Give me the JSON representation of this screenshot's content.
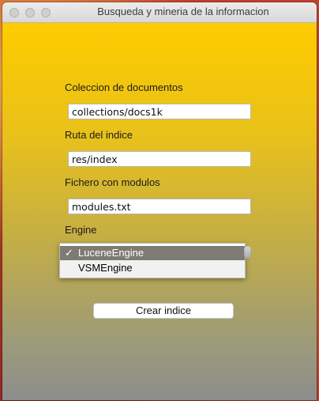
{
  "window": {
    "title": "Busqueda y mineria de la informacion"
  },
  "form": {
    "collection_label": "Coleccion de documentos",
    "collection_value": "collections/docs1k",
    "index_label": "Ruta del indice",
    "index_value": "res/index",
    "modules_label": "Fichero con modulos",
    "modules_value": "modules.txt",
    "engine_label": "Engine",
    "engine_options": [
      {
        "label": "LuceneEngine",
        "selected": true
      },
      {
        "label": "VSMEngine",
        "selected": false
      }
    ],
    "check_mark": "✓",
    "create_button_label": "Crear indice"
  },
  "colors": {
    "gradient_top": "#ffcc00",
    "gradient_bottom": "#8d8d8d",
    "selected_option_bg": "#7e7a74"
  }
}
